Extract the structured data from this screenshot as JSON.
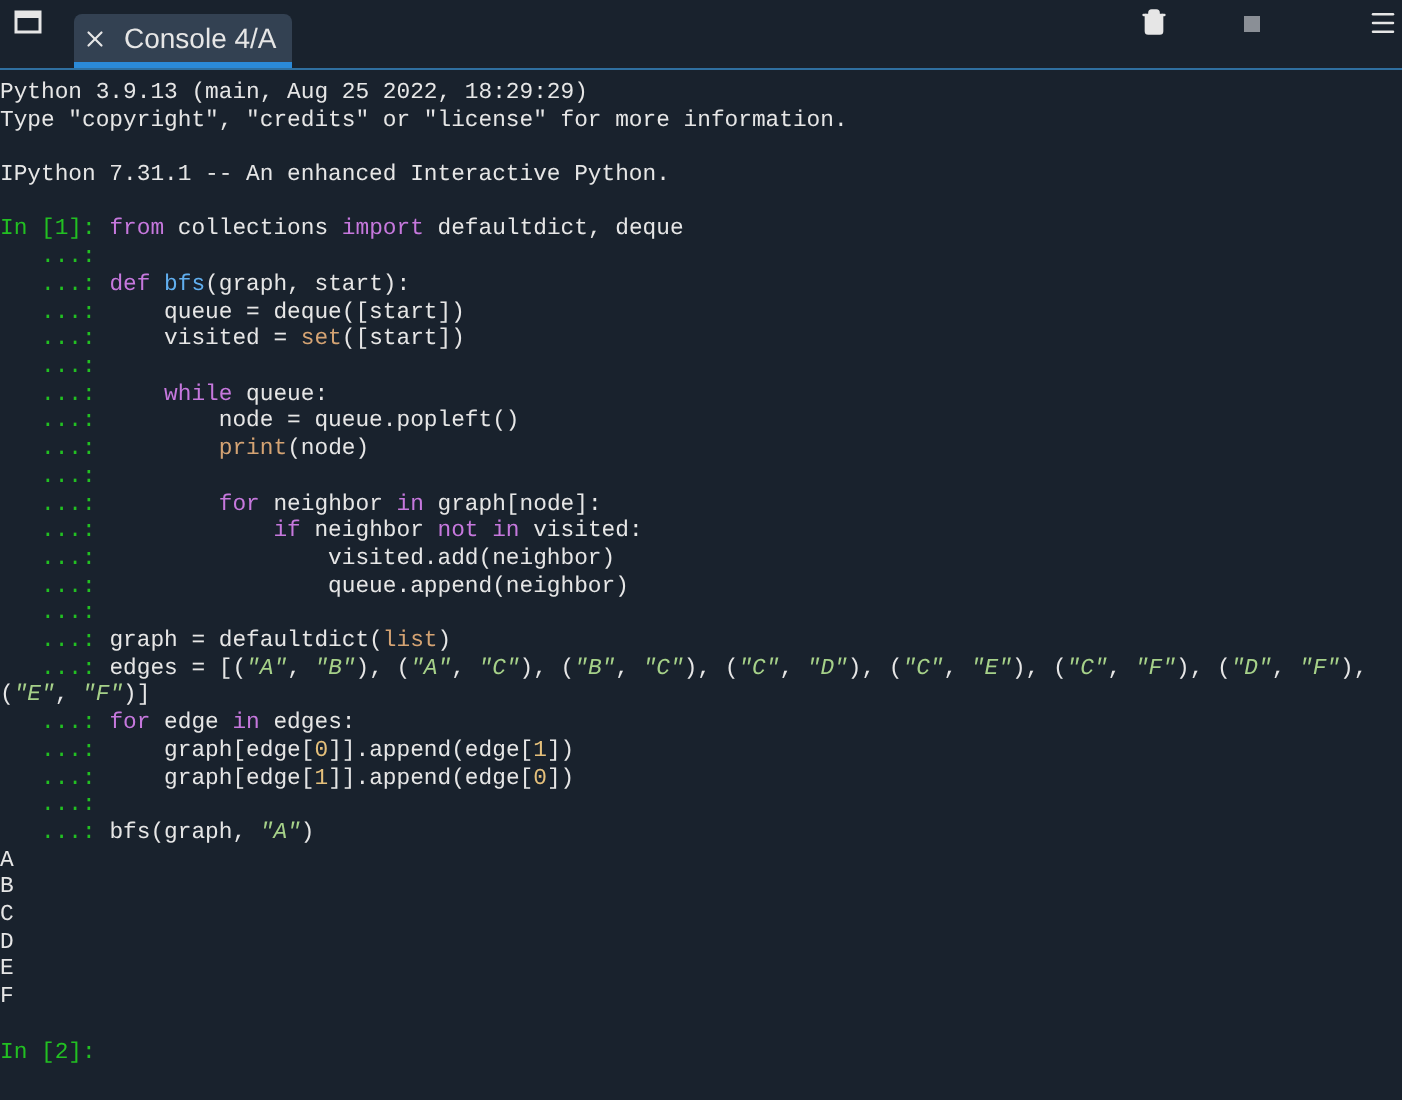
{
  "tabs": [
    {
      "label": "Console 4/A",
      "selected": true
    }
  ],
  "console": [
    {
      "kind": "output",
      "text": "Python 3.9.13 (main, Aug 25 2022, 18:29:29)"
    },
    {
      "kind": "output",
      "text": "Type \"copyright\", \"credits\" or \"license\" for more information."
    },
    {
      "kind": "blank"
    },
    {
      "kind": "output",
      "text": "IPython 7.31.1 -- An enhanced Interactive Python."
    },
    {
      "kind": "blank"
    },
    {
      "kind": "input",
      "prompt": "In [1]:",
      "tokens": [
        {
          "t": "from",
          "kind": "keyword"
        },
        {
          "t": " collections ",
          "kind": "plain"
        },
        {
          "t": "import",
          "kind": "keyword"
        },
        {
          "t": " defaultdict, deque",
          "kind": "plain"
        }
      ]
    },
    {
      "kind": "input",
      "prompt": "...:"
    },
    {
      "kind": "input",
      "prompt": "...:",
      "tokens": [
        {
          "t": "def ",
          "kind": "keyword"
        },
        {
          "t": "bfs",
          "kind": "function"
        },
        {
          "t": "(graph, start):",
          "kind": "plain"
        }
      ]
    },
    {
      "kind": "input",
      "prompt": "...:",
      "tokens": [
        {
          "t": "    queue = deque([start])",
          "kind": "plain"
        }
      ]
    },
    {
      "kind": "input",
      "prompt": "...:",
      "tokens": [
        {
          "t": "    visited = ",
          "kind": "plain"
        },
        {
          "t": "set",
          "kind": "builtin"
        },
        {
          "t": "([start])",
          "kind": "plain"
        }
      ]
    },
    {
      "kind": "input",
      "prompt": "...:"
    },
    {
      "kind": "input",
      "prompt": "...:",
      "tokens": [
        {
          "t": "    while",
          "kind": "keyword"
        },
        {
          "t": " queue:",
          "kind": "plain"
        }
      ]
    },
    {
      "kind": "input",
      "prompt": "...:",
      "tokens": [
        {
          "t": "        node = queue.popleft()",
          "kind": "plain"
        }
      ]
    },
    {
      "kind": "input",
      "prompt": "...:",
      "tokens": [
        {
          "t": "        print",
          "kind": "builtin"
        },
        {
          "t": "(node)",
          "kind": "plain"
        }
      ]
    },
    {
      "kind": "input",
      "prompt": "...:"
    },
    {
      "kind": "input",
      "prompt": "...:",
      "tokens": [
        {
          "t": "        for",
          "kind": "keyword"
        },
        {
          "t": " neighbor ",
          "kind": "plain"
        },
        {
          "t": "in",
          "kind": "keyword"
        },
        {
          "t": " graph[node]:",
          "kind": "plain"
        }
      ]
    },
    {
      "kind": "input",
      "prompt": "...:",
      "tokens": [
        {
          "t": "            if",
          "kind": "keyword"
        },
        {
          "t": " neighbor ",
          "kind": "plain"
        },
        {
          "t": "not in",
          "kind": "keyword"
        },
        {
          "t": " visited:",
          "kind": "plain"
        }
      ]
    },
    {
      "kind": "input",
      "prompt": "...:",
      "tokens": [
        {
          "t": "                visited.add(neighbor)",
          "kind": "plain"
        }
      ]
    },
    {
      "kind": "input",
      "prompt": "...:",
      "tokens": [
        {
          "t": "                queue.append(neighbor)",
          "kind": "plain"
        }
      ]
    },
    {
      "kind": "input",
      "prompt": "...:"
    },
    {
      "kind": "input",
      "prompt": "...:",
      "tokens": [
        {
          "t": "graph = defaultdict(",
          "kind": "plain"
        },
        {
          "t": "list",
          "kind": "builtin"
        },
        {
          "t": ")",
          "kind": "plain"
        }
      ]
    },
    {
      "kind": "input",
      "prompt": "...:",
      "tokens": [
        {
          "t": "edges = [(",
          "kind": "plain"
        },
        {
          "t": "\"A\"",
          "kind": "string"
        },
        {
          "t": ", ",
          "kind": "plain"
        },
        {
          "t": "\"B\"",
          "kind": "string"
        },
        {
          "t": "), (",
          "kind": "plain"
        },
        {
          "t": "\"A\"",
          "kind": "string"
        },
        {
          "t": ", ",
          "kind": "plain"
        },
        {
          "t": "\"C\"",
          "kind": "string"
        },
        {
          "t": "), (",
          "kind": "plain"
        },
        {
          "t": "\"B\"",
          "kind": "string"
        },
        {
          "t": ", ",
          "kind": "plain"
        },
        {
          "t": "\"C\"",
          "kind": "string"
        },
        {
          "t": "), (",
          "kind": "plain"
        },
        {
          "t": "\"C\"",
          "kind": "string"
        },
        {
          "t": ", ",
          "kind": "plain"
        },
        {
          "t": "\"D\"",
          "kind": "string"
        },
        {
          "t": "), (",
          "kind": "plain"
        },
        {
          "t": "\"C\"",
          "kind": "string"
        },
        {
          "t": ", ",
          "kind": "plain"
        },
        {
          "t": "\"E\"",
          "kind": "string"
        },
        {
          "t": "), (",
          "kind": "plain"
        },
        {
          "t": "\"C\"",
          "kind": "string"
        },
        {
          "t": ", ",
          "kind": "plain"
        },
        {
          "t": "\"F\"",
          "kind": "string"
        },
        {
          "t": "), (",
          "kind": "plain"
        },
        {
          "t": "\"D\"",
          "kind": "string"
        },
        {
          "t": ", ",
          "kind": "plain"
        },
        {
          "t": "\"F\"",
          "kind": "string"
        },
        {
          "t": "), (",
          "kind": "plain"
        },
        {
          "t": "\"E\"",
          "kind": "string"
        },
        {
          "t": ", ",
          "kind": "plain"
        },
        {
          "t": "\"F\"",
          "kind": "string"
        },
        {
          "t": ")]",
          "kind": "plain"
        }
      ]
    },
    {
      "kind": "input",
      "prompt": "...:",
      "tokens": [
        {
          "t": "for",
          "kind": "keyword"
        },
        {
          "t": " edge ",
          "kind": "plain"
        },
        {
          "t": "in",
          "kind": "keyword"
        },
        {
          "t": " edges:",
          "kind": "plain"
        }
      ]
    },
    {
      "kind": "input",
      "prompt": "...:",
      "tokens": [
        {
          "t": "    graph[edge[",
          "kind": "plain"
        },
        {
          "t": "0",
          "kind": "number"
        },
        {
          "t": "]].append(edge[",
          "kind": "plain"
        },
        {
          "t": "1",
          "kind": "number"
        },
        {
          "t": "])",
          "kind": "plain"
        }
      ]
    },
    {
      "kind": "input",
      "prompt": "...:",
      "tokens": [
        {
          "t": "    graph[edge[",
          "kind": "plain"
        },
        {
          "t": "1",
          "kind": "number"
        },
        {
          "t": "]].append(edge[",
          "kind": "plain"
        },
        {
          "t": "0",
          "kind": "number"
        },
        {
          "t": "])",
          "kind": "plain"
        }
      ]
    },
    {
      "kind": "input",
      "prompt": "...:"
    },
    {
      "kind": "input",
      "prompt": "...:",
      "tokens": [
        {
          "t": "bfs(graph, ",
          "kind": "plain"
        },
        {
          "t": "\"A\"",
          "kind": "string"
        },
        {
          "t": ")",
          "kind": "plain"
        }
      ]
    },
    {
      "kind": "output",
      "text": "A"
    },
    {
      "kind": "output",
      "text": "B"
    },
    {
      "kind": "output",
      "text": "C"
    },
    {
      "kind": "output",
      "text": "D"
    },
    {
      "kind": "output",
      "text": "E"
    },
    {
      "kind": "output",
      "text": "F"
    },
    {
      "kind": "blank"
    },
    {
      "kind": "input",
      "prompt": "In [2]:"
    }
  ]
}
